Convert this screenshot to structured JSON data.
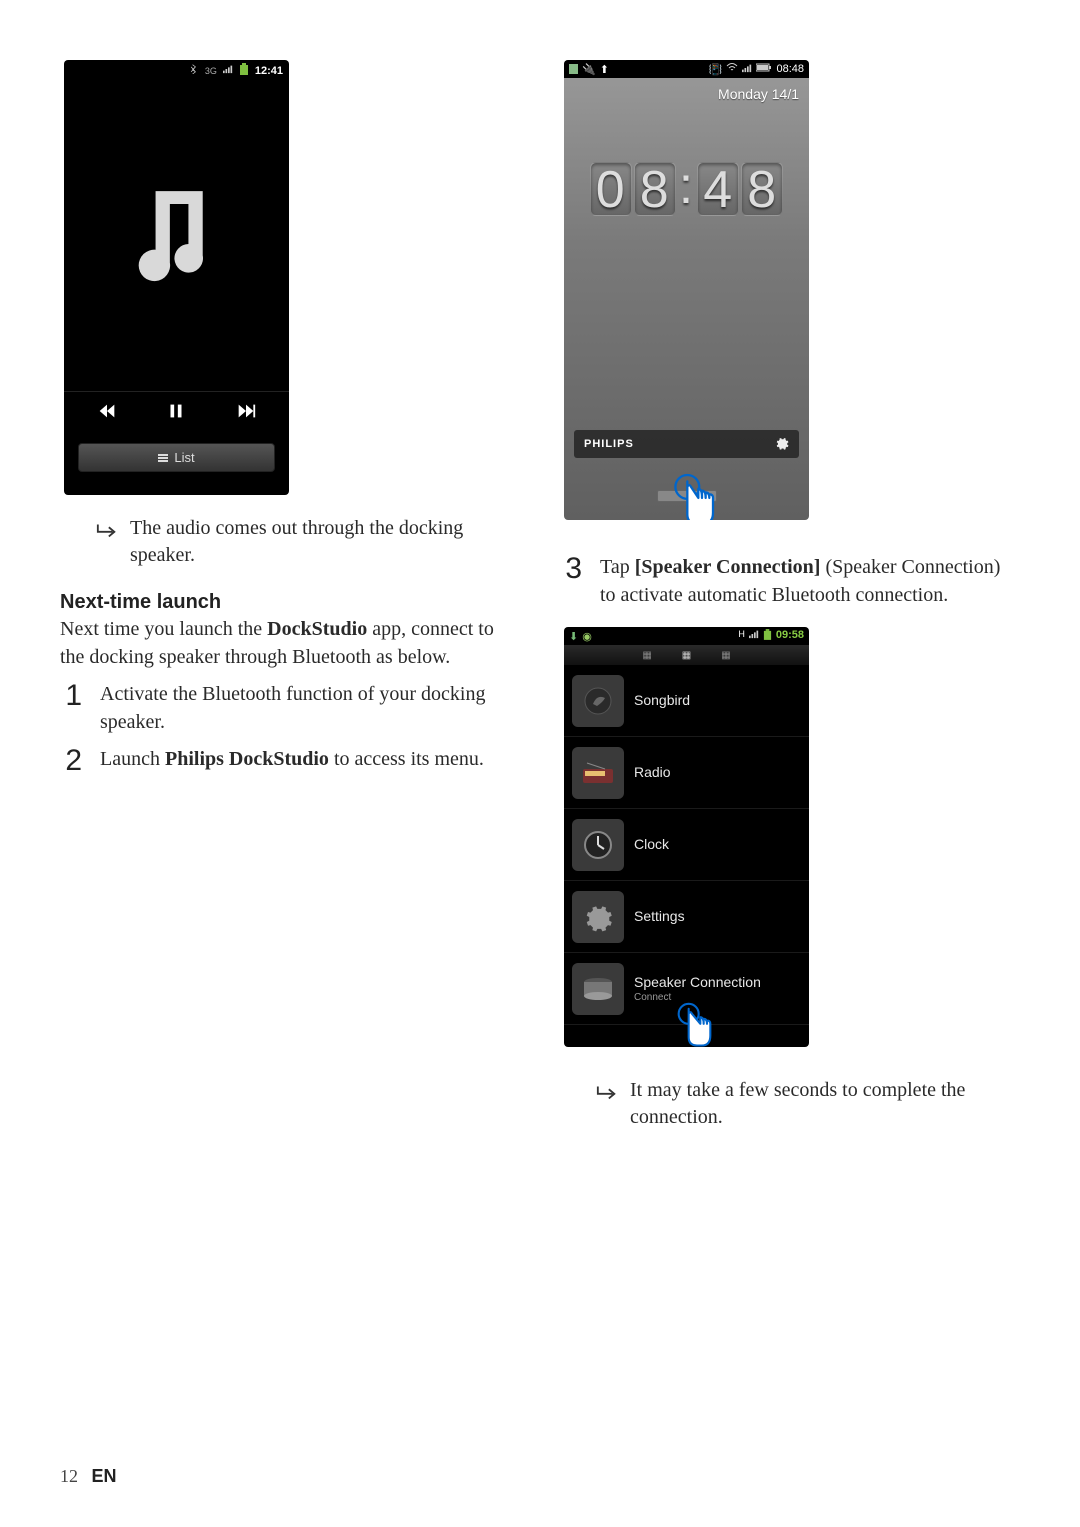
{
  "phone_player": {
    "status_time": "12:41",
    "list_button": "List"
  },
  "result_after_player": "The audio comes out through the docking speaker.",
  "nexttime_heading": "Next-time launch",
  "nexttime_intro_1": "Next time you launch the ",
  "nexttime_intro_app": "DockStudio",
  "nexttime_intro_2": " app, connect to the docking speaker through Bluetooth as below.",
  "step1": "Activate the Bluetooth function of your docking speaker.",
  "step2_a": "Launch ",
  "step2_b": "Philips DockStudio",
  "step2_c": " to access its menu.",
  "phone_home": {
    "status_time": "08:48",
    "date": "Monday 14/1",
    "clock_h1": "0",
    "clock_h2": "8",
    "clock_m1": "4",
    "clock_m2": "8",
    "brand": "PHILIPS"
  },
  "step3_a": "Tap ",
  "step3_b": "[Speaker Connection]",
  "step3_c": " (Speaker Connection) to activate automatic Bluetooth connection.",
  "phone_menu": {
    "status_time": "09:58",
    "items": [
      {
        "label": "Songbird",
        "sub": ""
      },
      {
        "label": "Radio",
        "sub": ""
      },
      {
        "label": "Clock",
        "sub": ""
      },
      {
        "label": "Settings",
        "sub": ""
      },
      {
        "label": "Speaker Connection",
        "sub": "Connect"
      }
    ]
  },
  "result_after_menu": "It may take a few seconds to complete the connection.",
  "page_number": "12",
  "lang": "EN"
}
